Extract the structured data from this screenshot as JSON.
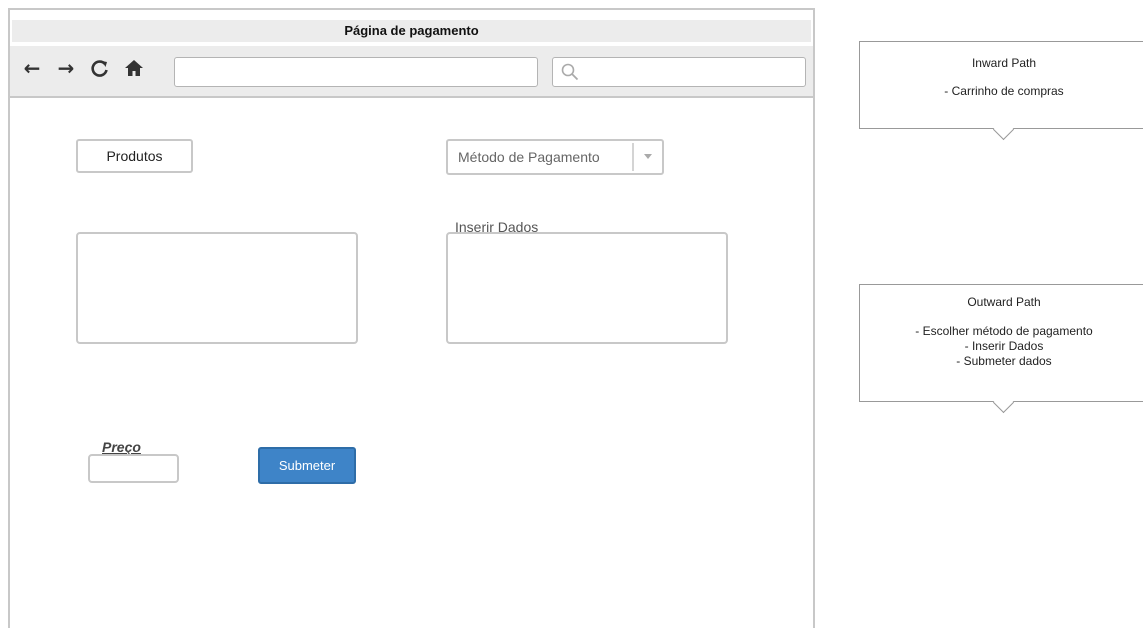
{
  "window": {
    "title": "Página de pagamento",
    "url_value": "",
    "search_value": ""
  },
  "toolbar": {
    "back_icon": "arrow-left-icon",
    "forward_icon": "arrow-right-icon",
    "reload_icon": "reload-icon",
    "home_icon": "home-icon",
    "search_icon": "search-icon"
  },
  "main": {
    "produtos_label": "Produtos",
    "payment_method": {
      "selected": "Método de Pagamento"
    },
    "inserir_dados_label": "Inserir Dados",
    "preco_label": "Preço",
    "preco_value": "",
    "submit_label": "Submeter"
  },
  "callouts": {
    "inward": {
      "title": "Inward Path",
      "lines": [
        "- Carrinho de compras"
      ]
    },
    "outward": {
      "title": "Outward Path",
      "lines": [
        "- Escolher método de pagamento",
        "- Inserir Dados",
        "- Submeter dados"
      ]
    }
  },
  "colors": {
    "submit_button": "#3e84c8",
    "frame_border": "#c8c8c8",
    "toolbar_bg": "#ececec"
  }
}
